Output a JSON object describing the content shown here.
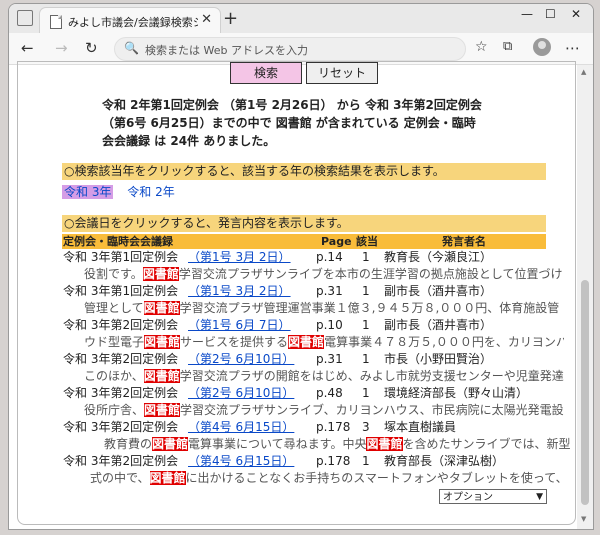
{
  "browser": {
    "tab_title": "みよし市議会/会議録検索システム",
    "tab_close": "✕",
    "new_tab": "+",
    "address_placeholder": "検索または Web アドレスを入力"
  },
  "buttons": {
    "search": "検索",
    "reset": "リセット"
  },
  "summary": {
    "line1": "令和 2年第1回定例会 （第1号 2月26日） から 令和 3年第2回定例会",
    "line2": "（第6号 6月25日）までの中で 図書館 が含まれている 定例会・臨時",
    "line3": "会会議録 は 24件 ありました。"
  },
  "year_bar": "○検索該当年をクリックすると、該当する年の検索結果を表示します。",
  "years": [
    "令和 3年",
    "令和 2年"
  ],
  "date_bar": "○会議日をクリックすると、発言内容を表示します。",
  "columns": {
    "session": "定例会・臨時会会議録",
    "page": "Page",
    "hit": "該当",
    "speaker": "発言者名"
  },
  "results": [
    {
      "session": "令和 3年第1回定例会",
      "date": "（第1号 3月 2日）",
      "page": "p.14",
      "hit": "1",
      "speaker": "教育長（今瀬良江）",
      "pre": "役割です。",
      "kw": "図書館",
      "post": "学習交流プラザサンライブを本市の生涯学習の拠点施設として位置づけ"
    },
    {
      "session": "令和 3年第1回定例会",
      "date": "（第1号 3月 2日）",
      "page": "p.31",
      "hit": "1",
      "speaker": "副市長（酒井喜市）",
      "pre": "管理として",
      "kw": "図書館",
      "post": "学習交流プラザ管理運営事業１億３,９４５万８,０００円、体育施設管"
    },
    {
      "session": "令和 3年第2回定例会",
      "date": "（第1号 6月 7日）",
      "page": "p.10",
      "hit": "1",
      "speaker": "副市長（酒井喜市）",
      "pre": "ウド型電子",
      "kw": "図書館",
      "post": "サービスを提供する",
      "kw2": "図書館",
      "post2": "電算事業４７８万５,０００円を、カリヨンハ"
    },
    {
      "session": "令和 3年第2回定例会",
      "date": "（第2号 6月10日）",
      "page": "p.31",
      "hit": "1",
      "speaker": "市長（小野田賢治）",
      "pre": "このほか、",
      "kw": "図書館",
      "post": "学習交流プラザの開館をはじめ、みよし市就労支援センターや児童発達"
    },
    {
      "session": "令和 3年第2回定例会",
      "date": "（第2号 6月10日）",
      "page": "p.48",
      "hit": "1",
      "speaker": "環境経済部長（野々山清）",
      "pre": "役所庁舎、",
      "kw": "図書館",
      "post": "学習交流プラザサンライブ、カリヨンハウス、市民病院に太陽光発電設"
    },
    {
      "session": "令和 3年第2回定例会",
      "date": "（第4号 6月15日）",
      "page": "p.178",
      "hit": "3",
      "speaker": "塚本直樹議員",
      "pre": "教育費の",
      "kw": "図書館",
      "post": "電算事業について尋ねます。中央",
      "kw2": "図書館",
      "post2": "を含めたサンライブでは、新型"
    },
    {
      "session": "令和 3年第2回定例会",
      "date": "（第4号 6月15日）",
      "page": "p.178",
      "hit": "1",
      "speaker": "教育部長（深津弘樹）",
      "pre": "式の中で、",
      "kw": "図書館",
      "post": "に出かけることなくお手持ちのスマートフォンやタブレットを使って、"
    }
  ],
  "select_option": "オプション"
}
